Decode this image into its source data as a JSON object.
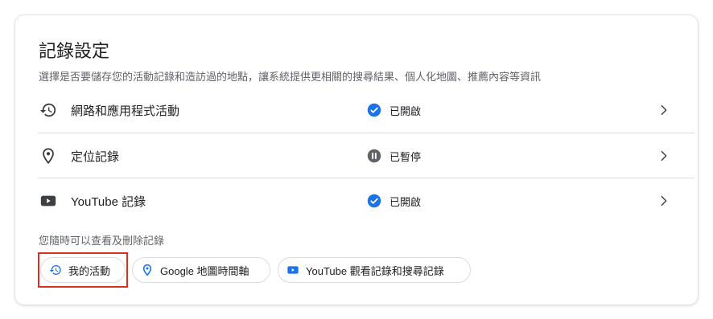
{
  "settings": {
    "title": "記錄設定",
    "subtitle": "選擇是否要儲存您的活動記錄和造訪過的地點，讓系統提供更相關的搜尋結果、個人化地圖、推薦內容等資訊",
    "rows": [
      {
        "label": "網路和應用程式活動",
        "status": "已開啟",
        "icon": "history-icon",
        "status_icon": "check-circle-icon"
      },
      {
        "label": "定位記錄",
        "status": "已暫停",
        "icon": "location-pin-icon",
        "status_icon": "pause-circle-icon"
      },
      {
        "label": "YouTube 記錄",
        "status": "已開啟",
        "icon": "youtube-icon",
        "status_icon": "check-circle-icon"
      }
    ],
    "caption": "您隨時可以查看及刪除記錄",
    "chips": [
      {
        "label": "我的活動",
        "icon": "history-icon"
      },
      {
        "label": "Google 地圖時間軸",
        "icon": "location-pin-icon"
      },
      {
        "label": "YouTube 觀看記錄和搜尋記錄",
        "icon": "youtube-icon"
      }
    ]
  },
  "colors": {
    "accent_blue": "#1a73e8",
    "paused_gray": "#5f6368",
    "highlight_red": "#d93025",
    "youtube_blue": "#1a73e8"
  }
}
